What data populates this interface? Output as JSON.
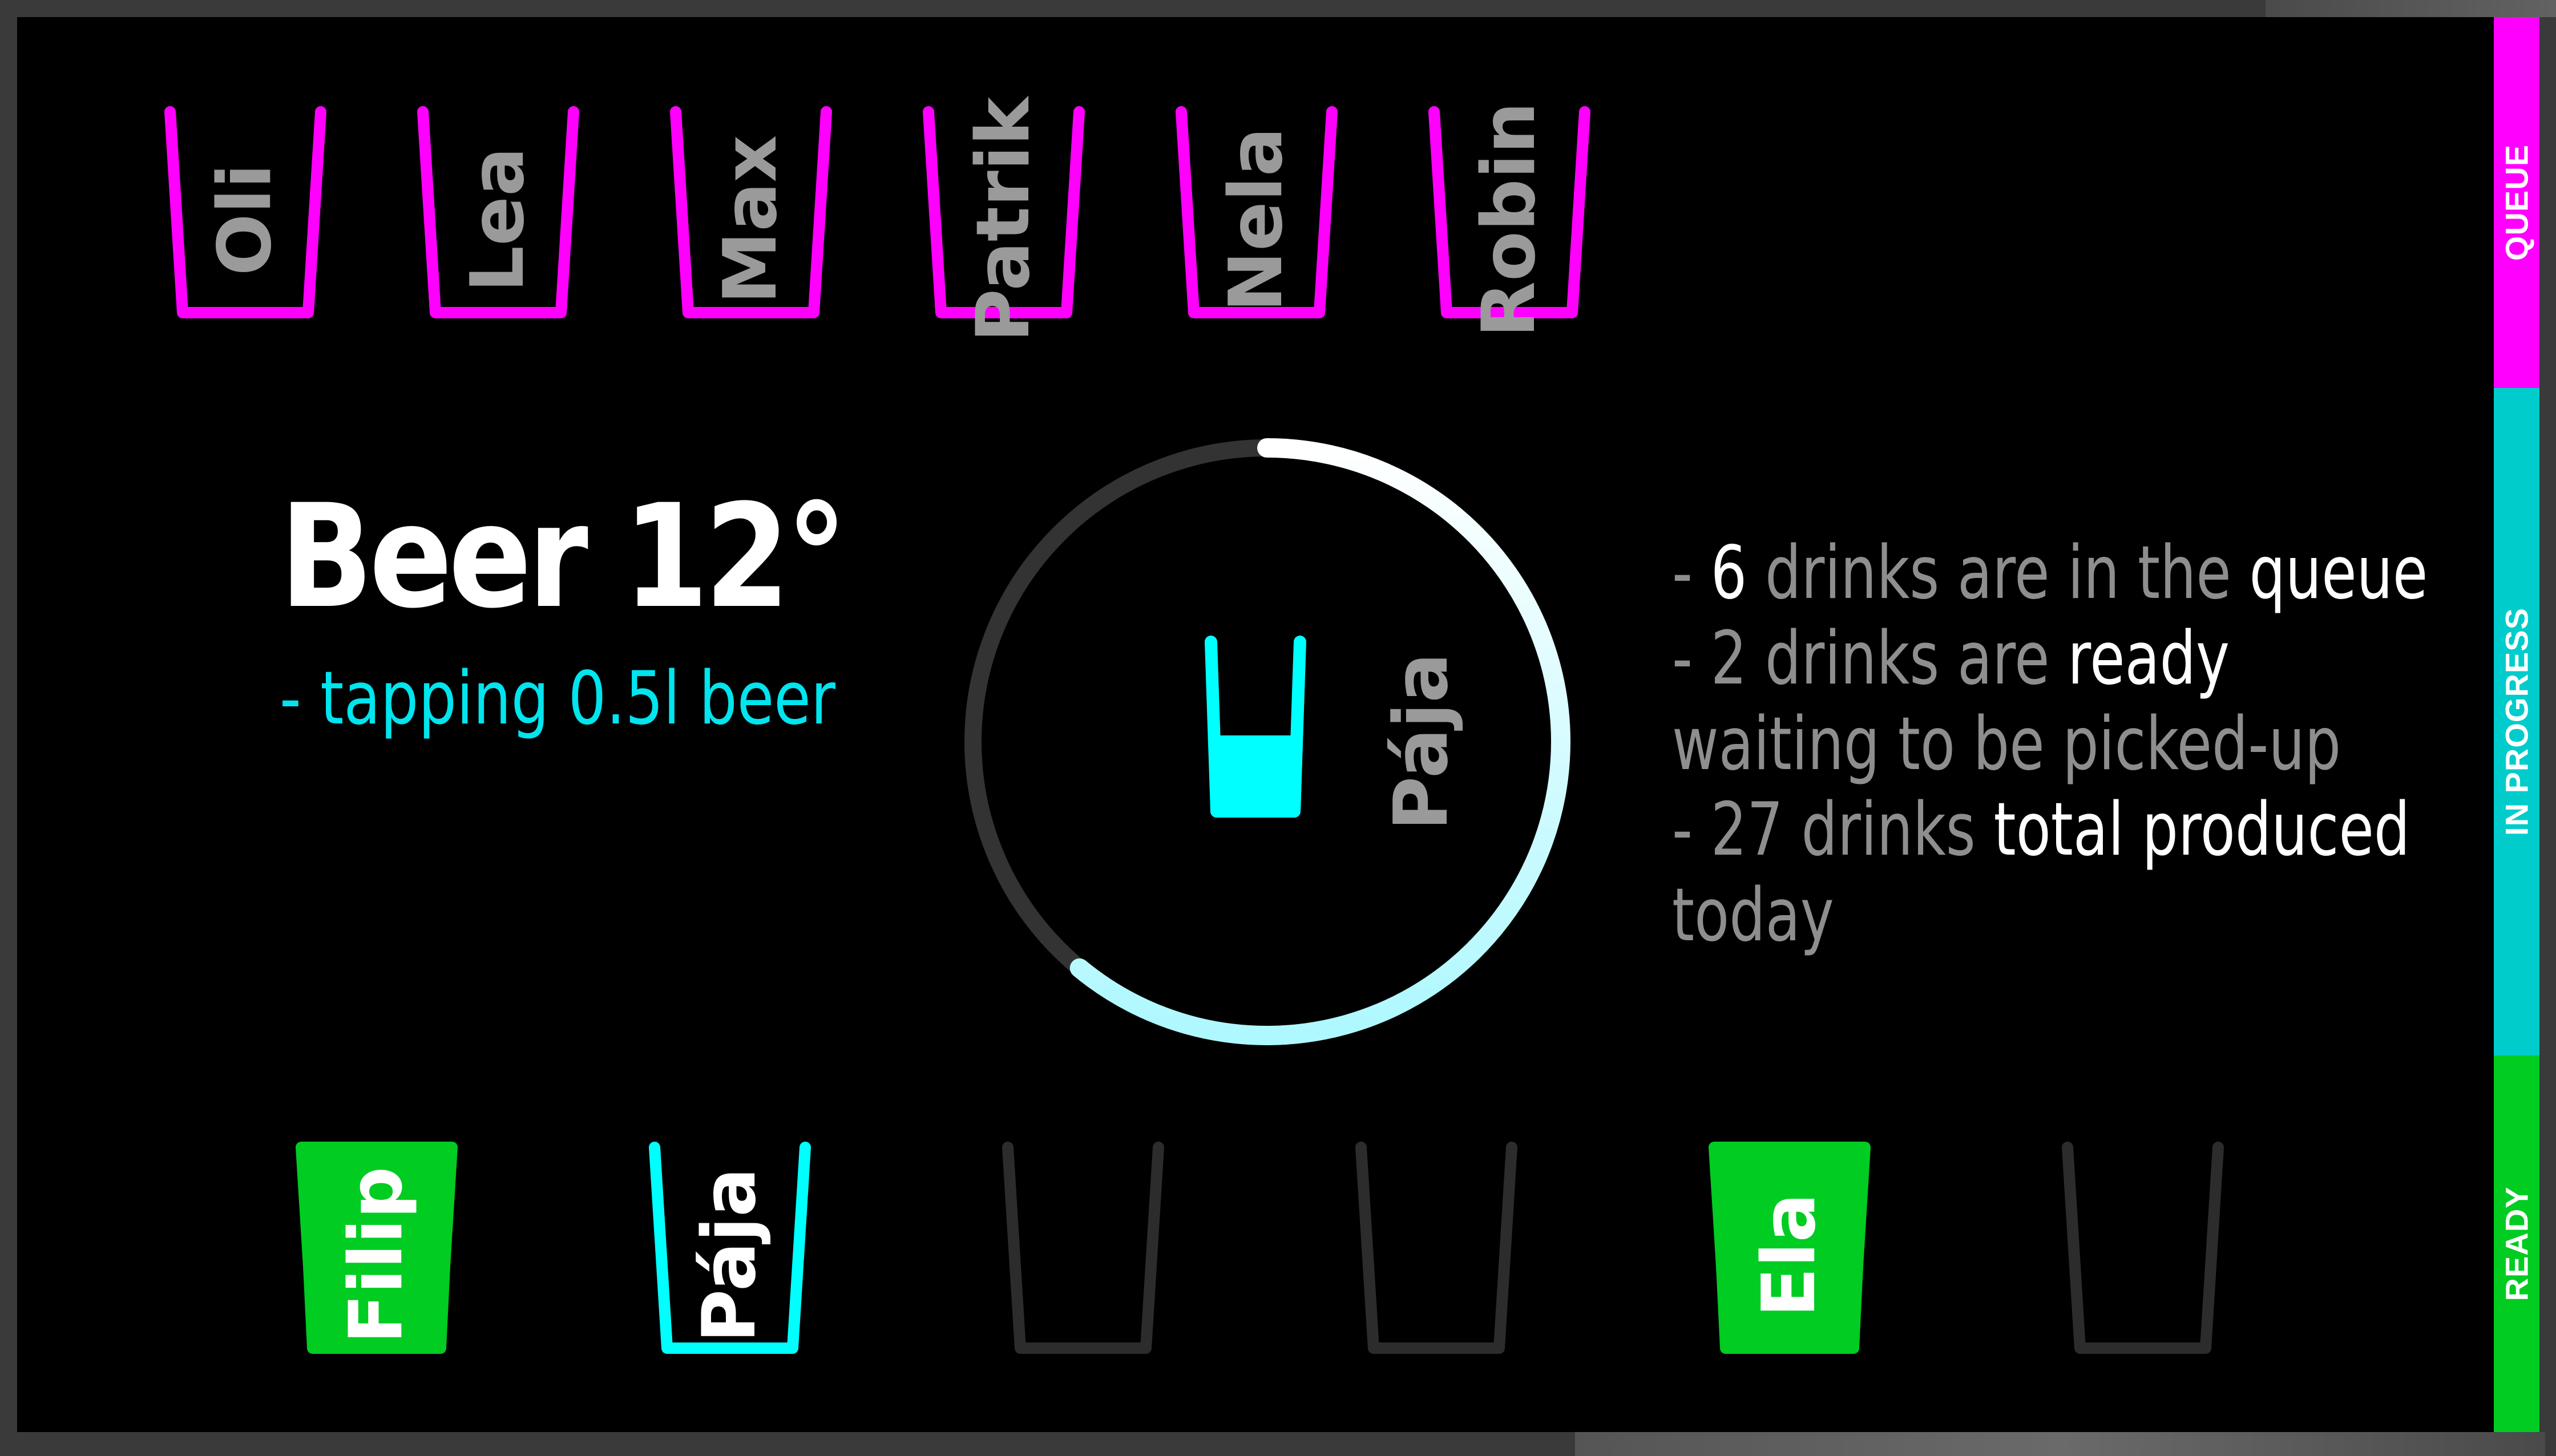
{
  "colors": {
    "queue": "#ff00ff",
    "in_progress": "#00cccc",
    "ready": "#00cc22",
    "cup_empty": "#2c2c2c",
    "cup_active": "#00ffff",
    "ring_track": "#333333"
  },
  "queue": [
    {
      "name": "Oli"
    },
    {
      "name": "Lea"
    },
    {
      "name": "Max"
    },
    {
      "name": "Patrik"
    },
    {
      "name": "Nela"
    },
    {
      "name": "Robin"
    }
  ],
  "current": {
    "drink_title": "Beer 12°",
    "drink_subtitle": "- tapping 0.5l beer",
    "person": "Pája",
    "progress": 0.61
  },
  "ready_slots": [
    {
      "name": "Filip",
      "state": "ready"
    },
    {
      "name": "Pája",
      "state": "active"
    },
    {
      "name": "",
      "state": "empty"
    },
    {
      "name": "",
      "state": "empty"
    },
    {
      "name": "Ela",
      "state": "ready"
    },
    {
      "name": "",
      "state": "empty"
    }
  ],
  "stats": {
    "line1_prefix": "- ",
    "line1_count": "6",
    "line1_mid": " drinks are in the ",
    "line1_hl": "queue",
    "line2_prefix": "- 2 drinks are ",
    "line2_hl": "ready",
    "line3": "waiting to be picked-up",
    "line4_prefix": "- 27 drinks ",
    "line4_hl": "total produced",
    "line5": "today"
  },
  "sidebar": {
    "queue_label": "QUEUE",
    "in_progress_label": "IN PROGRESS",
    "ready_label": "READY"
  }
}
